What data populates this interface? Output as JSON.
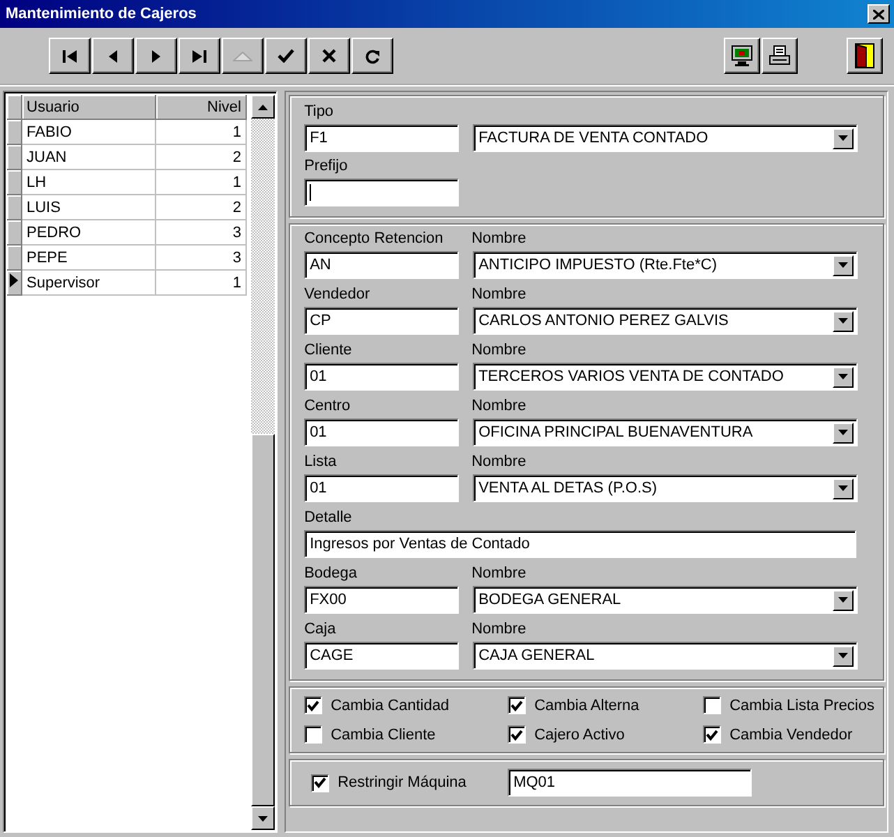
{
  "window": {
    "title": "Mantenimiento de Cajeros"
  },
  "toolbar": {
    "buttons": [
      {
        "kind": "first",
        "disabled": false
      },
      {
        "kind": "prev",
        "disabled": false
      },
      {
        "kind": "next",
        "disabled": false
      },
      {
        "kind": "last",
        "disabled": false
      },
      {
        "kind": "up",
        "disabled": true
      },
      {
        "kind": "confirm",
        "disabled": false
      },
      {
        "kind": "cancel",
        "disabled": false
      },
      {
        "kind": "refresh",
        "disabled": false
      }
    ],
    "tools": [
      {
        "kind": "monitor"
      },
      {
        "kind": "printer"
      }
    ],
    "exit": {
      "kind": "exit"
    }
  },
  "grid": {
    "columns": [
      "Usuario",
      "Nivel"
    ],
    "rows": [
      {
        "usuario": "FABIO",
        "nivel": "1",
        "selected": false
      },
      {
        "usuario": "JUAN",
        "nivel": "2",
        "selected": false
      },
      {
        "usuario": "LH",
        "nivel": "1",
        "selected": false
      },
      {
        "usuario": "LUIS",
        "nivel": "2",
        "selected": false
      },
      {
        "usuario": "PEDRO",
        "nivel": "3",
        "selected": false
      },
      {
        "usuario": "PEPE",
        "nivel": "3",
        "selected": false
      },
      {
        "usuario": "Supervisor",
        "nivel": "1",
        "selected": true
      }
    ]
  },
  "header_section": {
    "tipo": {
      "label": "Tipo",
      "code": "F1",
      "name": "FACTURA DE VENTA CONTADO"
    },
    "prefijo": {
      "label": "Prefijo"
    }
  },
  "detail_section": [
    {
      "kind": "lookup",
      "label": "Concepto Retencion",
      "code": "AN",
      "name_label": "Nombre",
      "name": "ANTICIPO IMPUESTO (Rte.Fte*C)"
    },
    {
      "kind": "lookup",
      "label": "Vendedor",
      "code": "CP",
      "name_label": "Nombre",
      "name": "CARLOS ANTONIO PEREZ GALVIS"
    },
    {
      "kind": "lookup",
      "label": "Cliente",
      "code": "01",
      "name_label": "Nombre",
      "name": "TERCEROS VARIOS VENTA DE CONTADO"
    },
    {
      "kind": "lookup",
      "label": "Centro",
      "code": "01",
      "name_label": "Nombre",
      "name": "OFICINA PRINCIPAL BUENAVENTURA"
    },
    {
      "kind": "lookup",
      "label": "Lista",
      "code": "01",
      "name_label": "Nombre",
      "name": "VENTA AL DETAS (P.O.S)"
    },
    {
      "kind": "text",
      "label": "Detalle",
      "value": "Ingresos por Ventas de Contado"
    },
    {
      "kind": "lookup",
      "label": "Bodega",
      "code": "FX00",
      "name_label": "Nombre",
      "name": "BODEGA GENERAL"
    },
    {
      "kind": "lookup",
      "label": "Caja",
      "code": "CAGE",
      "name_label": "Nombre",
      "name": "CAJA GENERAL"
    }
  ],
  "options": [
    {
      "label": "Cambia Cantidad",
      "checked": true
    },
    {
      "label": "Cambia Alterna",
      "checked": true
    },
    {
      "label": "Cambia Lista Precios",
      "checked": false
    },
    {
      "label": "Cambia Cliente",
      "checked": false
    },
    {
      "label": "Cajero Activo",
      "checked": true
    },
    {
      "label": "Cambia Vendedor",
      "checked": true
    }
  ],
  "machine": {
    "label": "Restringir Máquina",
    "checked": true,
    "value": "MQ01"
  }
}
